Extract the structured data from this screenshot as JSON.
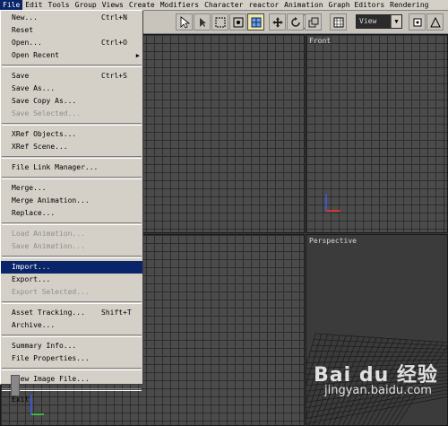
{
  "menubar": {
    "items": [
      "File",
      "Edit",
      "Tools",
      "Group",
      "Views",
      "Create",
      "Modifiers",
      "Character",
      "reactor",
      "Animation",
      "Graph Editors",
      "Rendering"
    ]
  },
  "toolbar": {
    "view_select": "View"
  },
  "viewports": {
    "top": "",
    "front": "Front",
    "left": "",
    "perspective": "Perspective"
  },
  "file_menu": {
    "groups": [
      [
        {
          "label": "New...",
          "shortcut": "Ctrl+N",
          "enabled": true
        },
        {
          "label": "Reset",
          "enabled": true
        },
        {
          "label": "Open...",
          "shortcut": "Ctrl+O",
          "enabled": true
        },
        {
          "label": "Open Recent",
          "submenu": true,
          "enabled": true
        }
      ],
      [
        {
          "label": "Save",
          "shortcut": "Ctrl+S",
          "enabled": true
        },
        {
          "label": "Save As...",
          "enabled": true
        },
        {
          "label": "Save Copy As...",
          "enabled": true
        },
        {
          "label": "Save Selected...",
          "enabled": false
        }
      ],
      [
        {
          "label": "XRef Objects...",
          "enabled": true
        },
        {
          "label": "XRef Scene...",
          "enabled": true
        }
      ],
      [
        {
          "label": "File Link Manager...",
          "enabled": true
        }
      ],
      [
        {
          "label": "Merge...",
          "enabled": true
        },
        {
          "label": "Merge Animation...",
          "enabled": true
        },
        {
          "label": "Replace...",
          "enabled": true
        }
      ],
      [
        {
          "label": "Load Animation...",
          "enabled": false
        },
        {
          "label": "Save Animation...",
          "enabled": false
        }
      ],
      [
        {
          "label": "Import...",
          "enabled": true,
          "highlighted": true
        },
        {
          "label": "Export...",
          "enabled": true
        },
        {
          "label": "Export Selected...",
          "enabled": false
        }
      ],
      [
        {
          "label": "Asset Tracking...",
          "shortcut": "Shift+T",
          "enabled": true
        },
        {
          "label": "Archive...",
          "enabled": true
        }
      ],
      [
        {
          "label": "Summary Info...",
          "enabled": true
        },
        {
          "label": "File Properties...",
          "enabled": true
        }
      ],
      [
        {
          "label": "View Image File...",
          "enabled": true
        }
      ],
      [
        {
          "label": "Exit",
          "enabled": true
        }
      ]
    ]
  },
  "watermark": {
    "brand": "Bai du 经验",
    "url": "jingyan.baidu.com"
  },
  "colors": {
    "menu_bg": "#d4d0c8",
    "highlight": "#0a246a",
    "viewport_bg": "#4b4b4b"
  }
}
